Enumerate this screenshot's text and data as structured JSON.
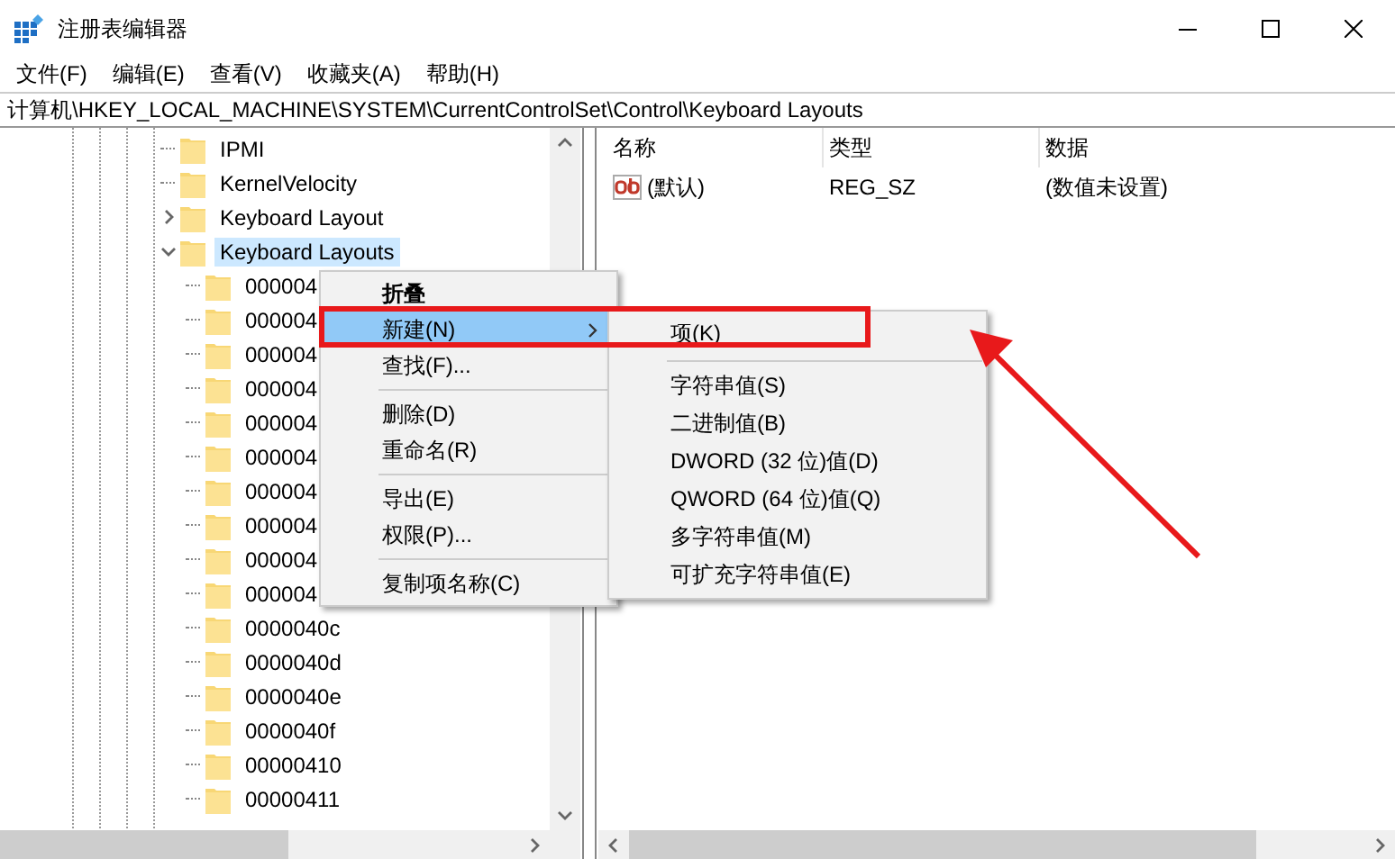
{
  "window": {
    "title": "注册表编辑器"
  },
  "menubar": [
    "文件(F)",
    "编辑(E)",
    "查看(V)",
    "收藏夹(A)",
    "帮助(H)"
  ],
  "address": "计算机\\HKEY_LOCAL_MACHINE\\SYSTEM\\CurrentControlSet\\Control\\Keyboard Layouts",
  "tree": [
    {
      "label": "IPMI",
      "selected": false
    },
    {
      "label": "KernelVelocity",
      "selected": false
    },
    {
      "label": "Keyboard Layout",
      "selected": false,
      "expanded": false
    },
    {
      "label": "Keyboard Layouts",
      "selected": true,
      "expanded": true,
      "children": [
        {
          "label": "000004",
          "selected": false
        },
        {
          "label": "000004",
          "selected": false
        },
        {
          "label": "000004",
          "selected": false
        },
        {
          "label": "000004",
          "selected": false
        },
        {
          "label": "000004",
          "selected": false
        },
        {
          "label": "000004",
          "selected": false
        },
        {
          "label": "000004",
          "selected": false
        },
        {
          "label": "000004",
          "selected": false
        },
        {
          "label": "000004",
          "selected": false
        },
        {
          "label": "000004",
          "selected": false
        },
        {
          "label": "0000040c",
          "selected": false
        },
        {
          "label": "0000040d",
          "selected": false
        },
        {
          "label": "0000040e",
          "selected": false
        },
        {
          "label": "0000040f",
          "selected": false
        },
        {
          "label": "00000410",
          "selected": false
        },
        {
          "label": "00000411",
          "selected": false
        }
      ]
    }
  ],
  "table": {
    "columns": [
      "名称",
      "类型",
      "数据"
    ],
    "rows": [
      [
        "(默认)",
        "REG_SZ",
        "(数值未设置)"
      ]
    ]
  },
  "context_menu": [
    {
      "kind": "item",
      "label": "折叠",
      "default": true,
      "selected": false
    },
    {
      "kind": "item",
      "label": "新建(N)",
      "default": false,
      "selected": true,
      "submenu": true
    },
    {
      "kind": "item",
      "label": "查找(F)...",
      "default": false,
      "selected": false
    },
    {
      "kind": "separator"
    },
    {
      "kind": "item",
      "label": "删除(D)",
      "default": false,
      "selected": false
    },
    {
      "kind": "item",
      "label": "重命名(R)",
      "default": false,
      "selected": false
    },
    {
      "kind": "separator"
    },
    {
      "kind": "item",
      "label": "导出(E)",
      "default": false,
      "selected": false
    },
    {
      "kind": "item",
      "label": "权限(P)...",
      "default": false,
      "selected": false
    },
    {
      "kind": "separator"
    },
    {
      "kind": "item",
      "label": "复制项名称(C)",
      "default": false,
      "selected": false
    }
  ],
  "submenu": [
    {
      "kind": "item",
      "label": "项(K)",
      "selected": false
    },
    {
      "kind": "separator"
    },
    {
      "kind": "item",
      "label": "字符串值(S)",
      "selected": false
    },
    {
      "kind": "item",
      "label": "二进制值(B)",
      "selected": false
    },
    {
      "kind": "item",
      "label": "DWORD (32 位)值(D)",
      "selected": false
    },
    {
      "kind": "item",
      "label": "QWORD (64 位)值(Q)",
      "selected": false
    },
    {
      "kind": "item",
      "label": "多字符串值(M)",
      "selected": false
    },
    {
      "kind": "item",
      "label": "可扩充字符串值(E)",
      "selected": false
    }
  ]
}
